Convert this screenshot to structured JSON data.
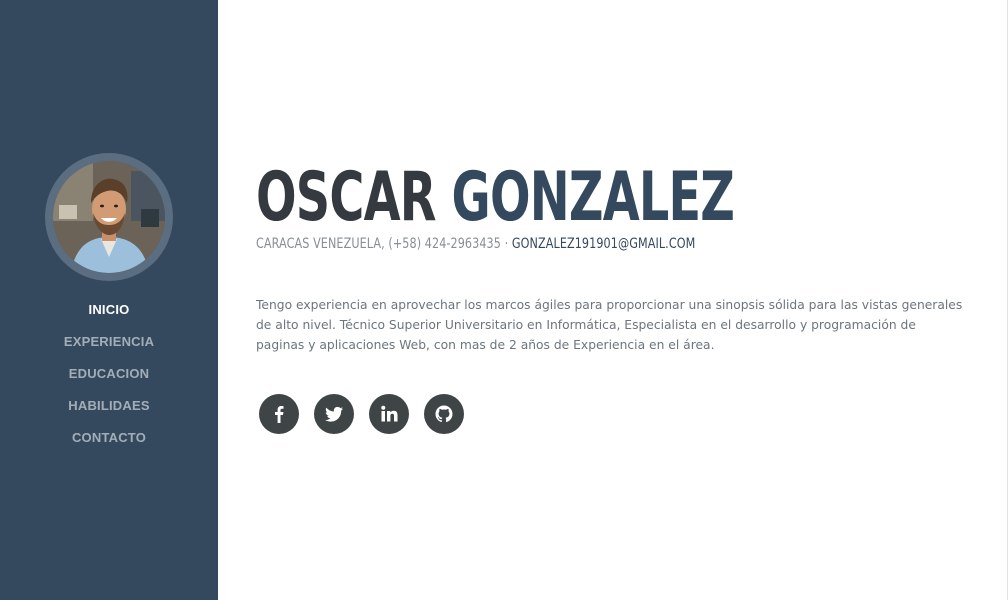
{
  "sidebar": {
    "nav": [
      {
        "label": "INICIO",
        "active": true
      },
      {
        "label": "EXPERIENCIA",
        "active": false
      },
      {
        "label": "EDUCACION",
        "active": false
      },
      {
        "label": "HABILIDAES",
        "active": false
      },
      {
        "label": "CONTACTO",
        "active": false
      }
    ]
  },
  "profile": {
    "first_name": "OSCAR",
    "last_name": "GONZALEZ",
    "location_phone": "CARACAS VENEZUELA, (+58) 424-2963435 · ",
    "email": "GONZALEZ191901@GMAIL.COM",
    "bio": "Tengo experiencia en aprovechar los marcos ágiles para proporcionar una sinopsis sólida para las vistas generales de alto nivel. Técnico Superior Universitario en Informática, Especialista en el desarrollo y programación de paginas y aplicaciones Web, con mas de 2 años de Experiencia en el área."
  },
  "social": [
    {
      "icon": "facebook-icon"
    },
    {
      "icon": "twitter-icon"
    },
    {
      "icon": "linkedin-icon"
    },
    {
      "icon": "github-icon"
    }
  ],
  "colors": {
    "sidebar_bg": "#34495e",
    "name_first": "#343a40",
    "name_last": "#34495e",
    "social_bg": "#3f4447"
  }
}
